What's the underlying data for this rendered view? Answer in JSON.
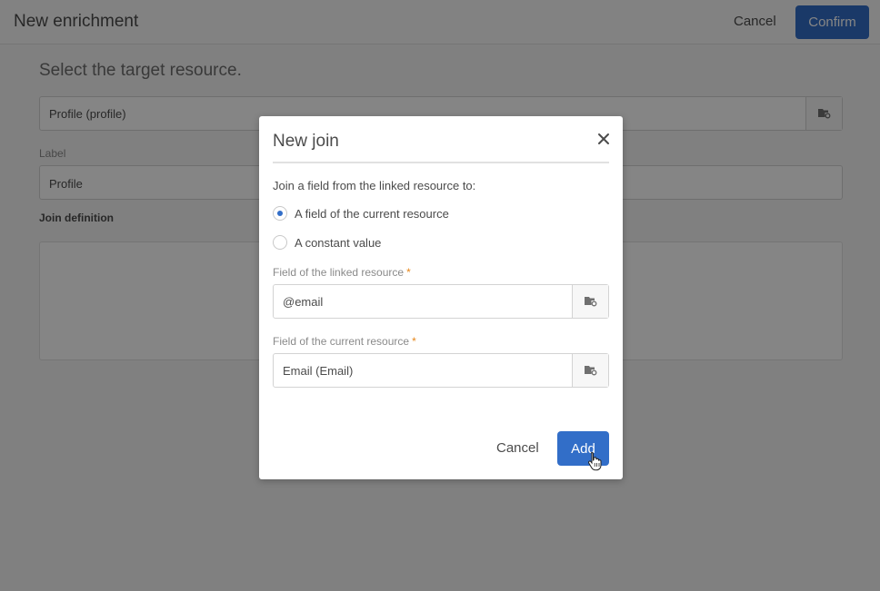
{
  "header": {
    "title": "New enrichment",
    "cancel_label": "Cancel",
    "confirm_label": "Confirm"
  },
  "main": {
    "section_title": "Select the target resource.",
    "target_resource_value": "Profile (profile)",
    "label_caption": "Label",
    "label_value": "Profile",
    "join_definition_heading": "Join definition"
  },
  "dialog": {
    "title": "New join",
    "instruction": "Join a field from the linked resource to:",
    "options": [
      {
        "label": "A field of the current resource",
        "selected": true
      },
      {
        "label": "A constant value",
        "selected": false
      }
    ],
    "linked_field": {
      "label": "Field of the linked resource",
      "required_mark": "*",
      "value": "@email"
    },
    "current_field": {
      "label": "Field of the current resource",
      "required_mark": "*",
      "value": "Email (Email)"
    },
    "cancel_label": "Cancel",
    "add_label": "Add"
  },
  "colors": {
    "accent": "#326ec8",
    "required": "#e68619"
  },
  "icons": [
    "folder-picker-icon",
    "close-icon",
    "hand-cursor-icon"
  ]
}
